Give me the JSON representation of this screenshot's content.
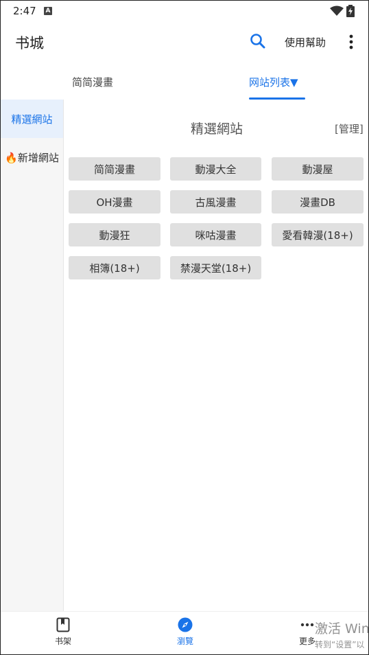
{
  "status_bar": {
    "time": "2:47",
    "notification_letter": "A",
    "wifi_icon": "wifi-icon",
    "battery_icon": "battery-charging-icon"
  },
  "app_bar": {
    "title": "书城",
    "search_icon": "search-icon",
    "help_label": "使用幫助",
    "more_icon": "more-vert-icon"
  },
  "top_tabs": [
    {
      "label": "简简漫畫",
      "active": false
    },
    {
      "label": "网站列表▼",
      "active": true
    }
  ],
  "side_nav": [
    {
      "label": "精選網站",
      "active": true
    },
    {
      "label": "🔥新增網站",
      "active": false
    }
  ],
  "content": {
    "title": "精選網站",
    "manage_label": "[管理]",
    "sites": [
      {
        "label": "简简漫畫"
      },
      {
        "label": "動漫大全"
      },
      {
        "label": "動漫屋"
      },
      {
        "label": "OH漫畫"
      },
      {
        "label": "古風漫畫"
      },
      {
        "label": "漫畫DB"
      },
      {
        "label": "動漫狂"
      },
      {
        "label": "咪咕漫畫"
      },
      {
        "label": "愛看韓漫(18+)"
      },
      {
        "label": "相簿(18+)"
      },
      {
        "label": "禁漫天堂(18+)"
      }
    ]
  },
  "bottom_nav": [
    {
      "label": "书架",
      "icon": "bookmark-book-icon",
      "active": false
    },
    {
      "label": "瀏覽",
      "icon": "compass-icon",
      "active": true
    },
    {
      "label": "更多",
      "icon": "more-horiz-icon",
      "active": false
    }
  ],
  "watermark": {
    "line1": "激活 Win",
    "line2": "转到“设置”以"
  },
  "colors": {
    "accent": "#1a73e8",
    "chip_bg": "#e0e0e0",
    "side_active_bg": "#e7f0fc"
  }
}
